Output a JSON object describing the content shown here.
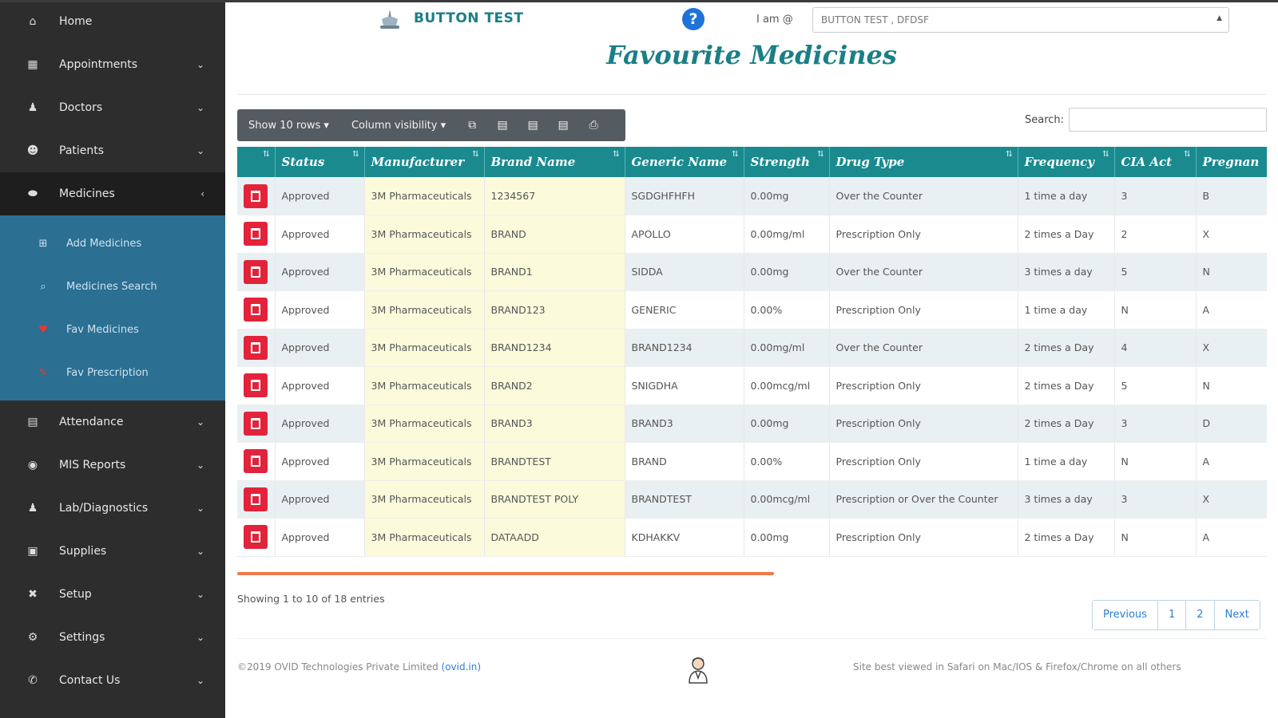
{
  "sidebar": {
    "items_top": [
      {
        "label": "Home",
        "icon": "home-icon",
        "glyph": "⌂",
        "chevron": ""
      },
      {
        "label": "Appointments",
        "icon": "calendar-icon",
        "glyph": "▦",
        "chevron": "⌄"
      },
      {
        "label": "Doctors",
        "icon": "doctor-icon",
        "glyph": "♟",
        "chevron": "⌄"
      },
      {
        "label": "Patients",
        "icon": "patients-icon",
        "glyph": "☻",
        "chevron": "⌄"
      },
      {
        "label": "Medicines",
        "icon": "pills-icon",
        "glyph": "⬬",
        "chevron": "‹"
      }
    ],
    "sub_items": [
      {
        "label": "Add Medicines",
        "icon": "plus-square-icon",
        "glyph": "⊞"
      },
      {
        "label": "Medicines Search",
        "icon": "search-icon",
        "glyph": "⌕"
      },
      {
        "label": "Fav Medicines",
        "icon": "heart-icon",
        "glyph": "♥"
      },
      {
        "label": "Fav Prescription",
        "icon": "prescription-icon",
        "glyph": "✎"
      }
    ],
    "items_bottom": [
      {
        "label": "Attendance",
        "icon": "book-icon",
        "glyph": "▤",
        "chevron": "⌄"
      },
      {
        "label": "MIS Reports",
        "icon": "report-icon",
        "glyph": "◉",
        "chevron": "⌄"
      },
      {
        "label": "Lab/Diagnostics",
        "icon": "lab-icon",
        "glyph": "♟",
        "chevron": "⌄"
      },
      {
        "label": "Supplies",
        "icon": "supplies-icon",
        "glyph": "▣",
        "chevron": "⌄"
      },
      {
        "label": "Setup",
        "icon": "tools-icon",
        "glyph": "✖",
        "chevron": "⌄"
      },
      {
        "label": "Settings",
        "icon": "gear-icon",
        "glyph": "⚙",
        "chevron": "⌄"
      },
      {
        "label": "Contact Us",
        "icon": "phone-icon",
        "glyph": "✆",
        "chevron": "⌄"
      }
    ]
  },
  "header": {
    "app_name": "BUTTON TEST",
    "help": "?",
    "iam_label": "I am @",
    "org_selected": "BUTTON TEST , DFDSF"
  },
  "page": {
    "title": "Favourite Medicines"
  },
  "toolbar": {
    "show_rows": "Show 10 rows ▾",
    "column_visibility": "Column visibility ▾",
    "icons": [
      {
        "name": "copy-icon",
        "glyph": "⧉"
      },
      {
        "name": "excel-icon",
        "glyph": "▤"
      },
      {
        "name": "csv-icon",
        "glyph": "▤"
      },
      {
        "name": "pdf-icon",
        "glyph": "▤"
      },
      {
        "name": "print-icon",
        "glyph": "⎙"
      }
    ],
    "search_label": "Search:",
    "search_value": ""
  },
  "table": {
    "columns": [
      "",
      "Status",
      "Manufacturer",
      "Brand Name",
      "Generic Name",
      "Strength",
      "Drug Type",
      "Frequency",
      "CIA Act",
      "Pregnan"
    ],
    "rows": [
      [
        "Approved",
        "3M Pharmaceuticals",
        "1234567",
        "SGDGHFHFH",
        "0.00mg",
        "Over the Counter",
        "1 time a day",
        "3",
        "B"
      ],
      [
        "Approved",
        "3M Pharmaceuticals",
        "BRAND",
        "APOLLO",
        "0.00mg/ml",
        "Prescription Only",
        "2 times a Day",
        "2",
        "X"
      ],
      [
        "Approved",
        "3M Pharmaceuticals",
        "BRAND1",
        "SIDDA",
        "0.00mg",
        "Over the Counter",
        "3 times a day",
        "5",
        "N"
      ],
      [
        "Approved",
        "3M Pharmaceuticals",
        "BRAND123",
        "GENERIC",
        "0.00%",
        "Prescription Only",
        "1 time a day",
        "N",
        "A"
      ],
      [
        "Approved",
        "3M Pharmaceuticals",
        "BRAND1234",
        "BRAND1234",
        "0.00mg/ml",
        "Over the Counter",
        "2 times a Day",
        "4",
        "X"
      ],
      [
        "Approved",
        "3M Pharmaceuticals",
        "BRAND2",
        "SNIGDHA",
        "0.00mcg/ml",
        "Prescription Only",
        "2 times a Day",
        "5",
        "N"
      ],
      [
        "Approved",
        "3M Pharmaceuticals",
        "BRAND3",
        "BRAND3",
        "0.00mg",
        "Prescription Only",
        "2 times a Day",
        "3",
        "D"
      ],
      [
        "Approved",
        "3M Pharmaceuticals",
        "BRANDTEST",
        "BRAND",
        "0.00%",
        "Prescription Only",
        "1 time a day",
        "N",
        "A"
      ],
      [
        "Approved",
        "3M Pharmaceuticals",
        "BRANDTEST POLY",
        "BRANDTEST",
        "0.00mcg/ml",
        "Prescription or Over the Counter",
        "3 times a day",
        "3",
        "X"
      ],
      [
        "Approved",
        "3M Pharmaceuticals",
        "DATAADD",
        "KDHAKKV",
        "0.00mg",
        "Prescription Only",
        "2 times a Day",
        "N",
        "A"
      ]
    ]
  },
  "footer": {
    "info": "Showing 1 to 10 of 18 entries",
    "pagination": [
      "Previous",
      "1",
      "2",
      "Next"
    ],
    "copyright": "©2019 OVID Technologies Private Limited",
    "copyright_link": "(ovid.in)",
    "best_viewed": "Site best viewed in Safari on Mac/IOS & Firefox/Chrome on all others"
  },
  "colors": {
    "sidebar": "#2d2d2d",
    "submenu": "#2b6f93",
    "accent": "#1a7f86",
    "table_header": "#1a8a8f",
    "delete": "#e2233a",
    "scroll": "#f07a4a"
  }
}
